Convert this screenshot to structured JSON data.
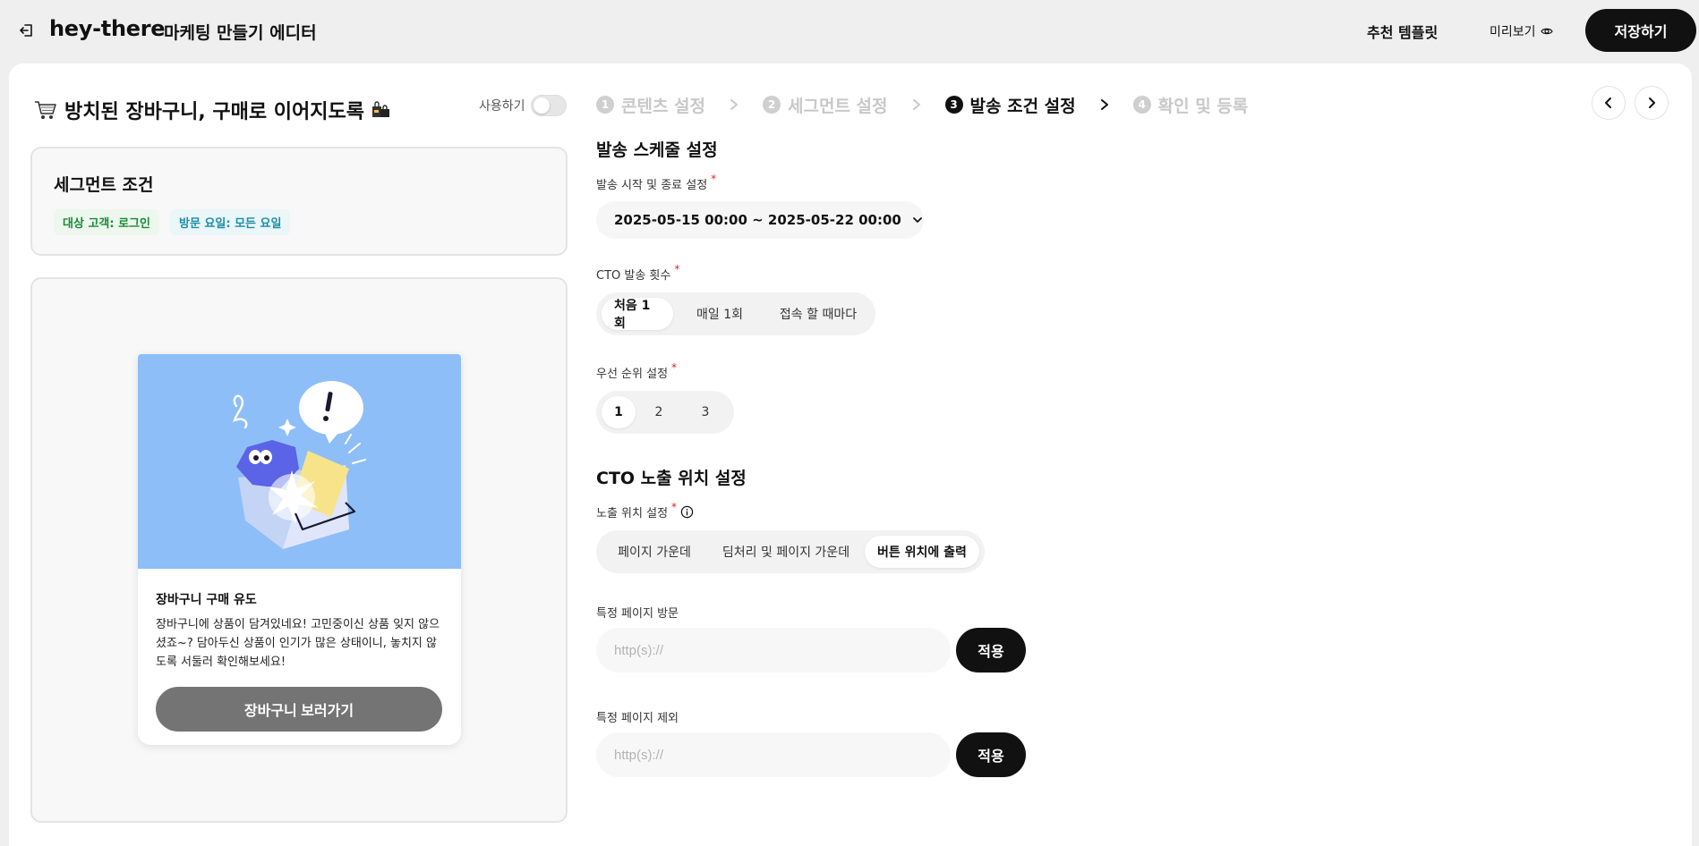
{
  "header": {
    "brand": "hey-there",
    "editor_title": "마케팅 만들기 에디터",
    "template_link": "추천 템플릿",
    "preview_link": "미리보기",
    "save_button": "저장하기"
  },
  "campaign": {
    "title": "방치된 장바구니, 구매로 이어지도록",
    "use_toggle_label": "사용하기",
    "use_toggle_on": false
  },
  "segment": {
    "title": "세그먼트 조건",
    "tags": [
      "대상 고객: 로그인",
      "방문 요일: 모든 요일"
    ]
  },
  "popup": {
    "title": "장바구니 구매 유도",
    "body": "장바구니에 상품이 담겨있네요! 고민중이신 상품 잊지 않으셨죠~? 담아두신 상품이 인기가 많은 상태이니, 놓치지 않도록 서둘러 확인해보세요!",
    "cta": "장바구니 보러가기"
  },
  "steps": [
    {
      "num": "1",
      "label": "콘텐츠 설정",
      "active": false
    },
    {
      "num": "2",
      "label": "세그먼트 설정",
      "active": false
    },
    {
      "num": "3",
      "label": "발송 조건 설정",
      "active": true
    },
    {
      "num": "4",
      "label": "확인 및 등록",
      "active": false
    }
  ],
  "schedule": {
    "section_title": "발송 스케줄 설정",
    "date_label": "발송 시작 및 종료 설정",
    "date_range": "2025-05-15 00:00 ~ 2025-05-22 00:00",
    "freq_label": "CTO 발송 횟수",
    "freq_options": [
      "처음 1회",
      "매일 1회",
      "접속 할 때마다"
    ],
    "freq_selected": 0,
    "priority_label": "우선 순위 설정",
    "priority_options": [
      "1",
      "2",
      "3"
    ],
    "priority_selected": 0
  },
  "position": {
    "section_title": "CTO 노출 위치 설정",
    "position_label": "노출 위치 설정",
    "position_options": [
      "페이지 가운데",
      "딤처리 및 페이지 가운데",
      "버튼 위치에 출력"
    ],
    "position_selected": 2,
    "include_label": "특정 페이지 방문",
    "include_placeholder": "http(s)://",
    "exclude_label": "특정 페이지 제외",
    "exclude_placeholder": "http(s)://",
    "apply_label": "적용"
  }
}
